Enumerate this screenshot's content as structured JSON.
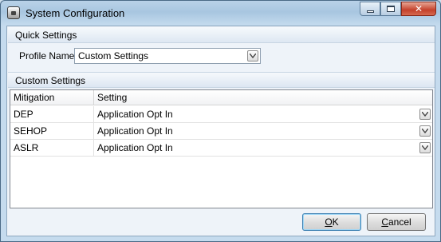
{
  "window": {
    "title": "System Configuration"
  },
  "quick_settings": {
    "header": "Quick Settings",
    "profile_label": "Profile Name",
    "profile_value": "Custom Settings"
  },
  "custom_settings": {
    "header": "Custom Settings",
    "columns": [
      "Mitigation",
      "Setting"
    ],
    "rows": [
      {
        "mitigation": "DEP",
        "setting": "Application Opt In"
      },
      {
        "mitigation": "SEHOP",
        "setting": "Application Opt In"
      },
      {
        "mitigation": "ASLR",
        "setting": "Application Opt In"
      }
    ]
  },
  "buttons": {
    "ok_first": "O",
    "ok_rest": "K",
    "cancel_first": "C",
    "cancel_rest": "ancel"
  },
  "icons": {
    "app": "app-icon",
    "minimize": "minimize-icon",
    "maximize": "maximize-icon",
    "close": "close-icon",
    "dropdown": "chevron-down-icon"
  }
}
